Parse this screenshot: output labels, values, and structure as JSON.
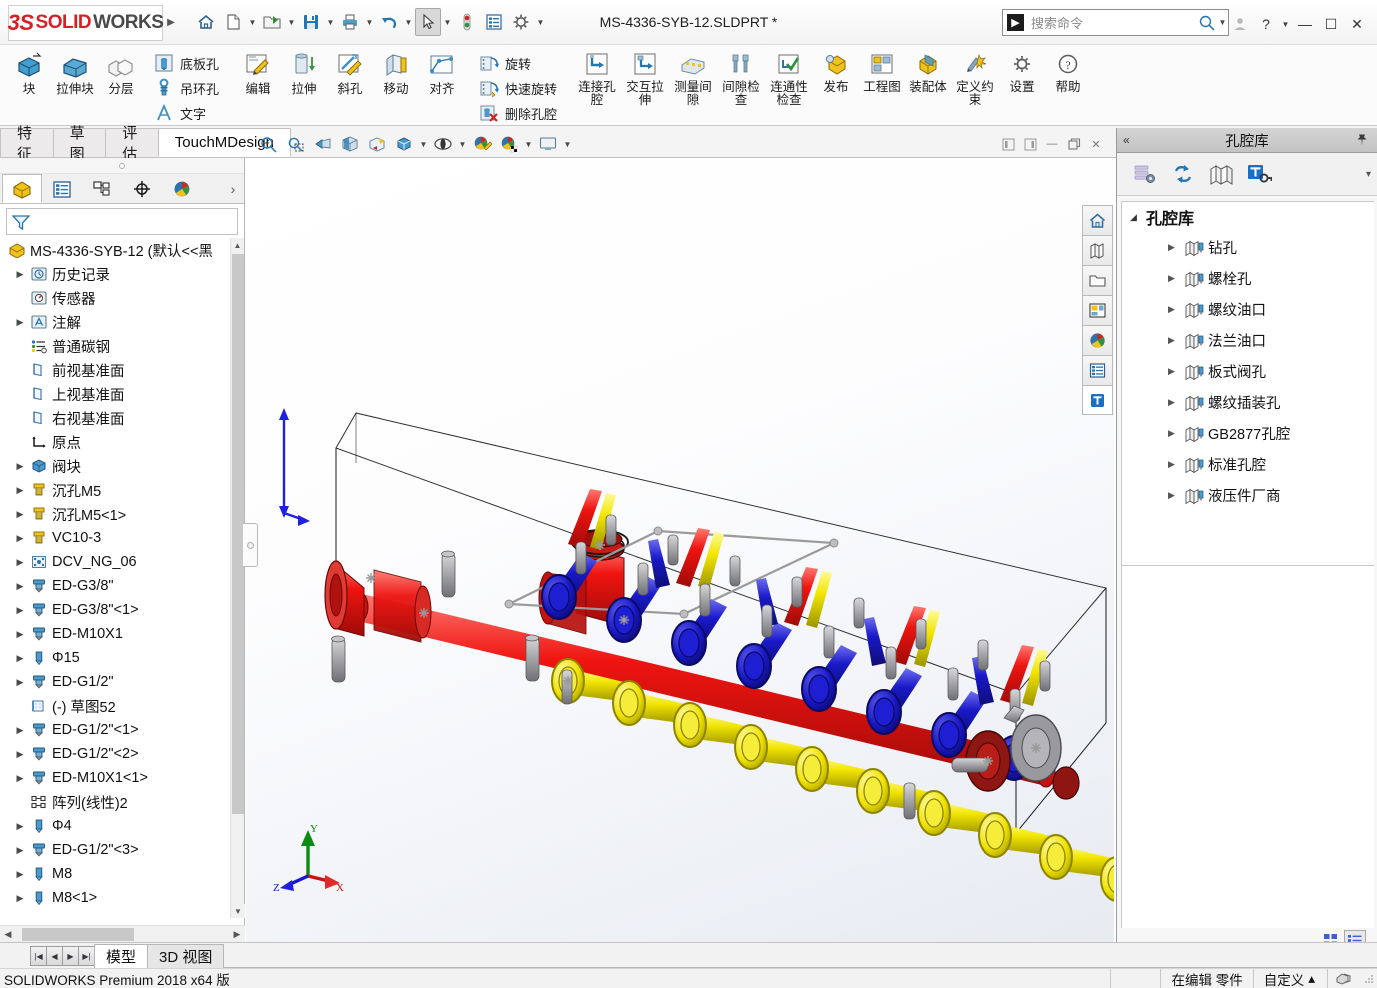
{
  "titlebar": {
    "logo_ds": "3S",
    "logo_solid": "SOLID",
    "logo_works": "WORKS",
    "document_title": "MS-4336-SYB-12.SLDPRT *",
    "search_placeholder": "搜索命令",
    "icons": [
      "home-icon",
      "new-document-icon",
      "open-folder-icon",
      "save-icon",
      "print-icon",
      "undo-icon",
      "select-cursor-icon",
      "rebuild-icon",
      "options-list-icon",
      "settings-gear-icon"
    ],
    "window_buttons": [
      "user-account-icon",
      "help-icon",
      "minimize-icon",
      "maximize-icon",
      "close-icon"
    ]
  },
  "ribbon": {
    "groups": [
      {
        "type": "big",
        "items": [
          {
            "label": "块",
            "label2": "",
            "icon": "block-icon"
          },
          {
            "label": "拉伸块",
            "label2": "",
            "icon": "extrude-block-icon"
          },
          {
            "label": "分层",
            "label2": "",
            "icon": "layer-icon"
          }
        ]
      },
      {
        "type": "stack",
        "items": [
          {
            "label": "底板孔",
            "icon": "base-plate-hole-icon"
          },
          {
            "label": "吊环孔",
            "icon": "eye-bolt-hole-icon"
          },
          {
            "label": "文字",
            "icon": "text-a-icon"
          }
        ]
      },
      {
        "type": "big",
        "items": [
          {
            "label": "编辑",
            "label2": "",
            "icon": "edit-wand-icon"
          },
          {
            "label": "拉伸",
            "label2": "",
            "icon": "extrude-icon"
          },
          {
            "label": "斜孔",
            "label2": "",
            "icon": "angled-hole-icon"
          },
          {
            "label": "移动",
            "label2": "",
            "icon": "move-icon"
          },
          {
            "label": "对齐",
            "label2": "",
            "icon": "align-icon"
          }
        ]
      },
      {
        "type": "stack",
        "items": [
          {
            "label": "旋转",
            "icon": "rotate-icon"
          },
          {
            "label": "快速旋转",
            "icon": "quick-rotate-icon"
          },
          {
            "label": "删除孔腔",
            "icon": "delete-cavity-icon"
          }
        ]
      },
      {
        "type": "big",
        "items": [
          {
            "label": "连接孔",
            "label2": "腔",
            "icon": "connect-hole-icon"
          },
          {
            "label": "交互拉",
            "label2": "伸",
            "icon": "interactive-extrude-icon"
          },
          {
            "label": "测量间",
            "label2": "隙",
            "icon": "measure-gap-icon"
          },
          {
            "label": "间隙检",
            "label2": "查",
            "icon": "clearance-check-icon"
          },
          {
            "label": "连通性",
            "label2": "检查",
            "icon": "connectivity-check-icon"
          },
          {
            "label": "发布",
            "label2": "",
            "icon": "publish-icon"
          },
          {
            "label": "工程图",
            "label2": "",
            "icon": "drawing-icon"
          },
          {
            "label": "装配体",
            "label2": "",
            "icon": "assembly-icon"
          },
          {
            "label": "定义约",
            "label2": "束",
            "icon": "define-constraint-icon"
          },
          {
            "label": "设置",
            "label2": "",
            "icon": "settings-icon"
          },
          {
            "label": "帮助",
            "label2": "",
            "icon": "help-circle-icon"
          }
        ]
      }
    ]
  },
  "command_tabs": {
    "tabs": [
      {
        "label": "特征",
        "active": false
      },
      {
        "label": "草图",
        "active": false
      },
      {
        "label": "评估",
        "active": false
      },
      {
        "label": "TouchMDesign",
        "active": true
      }
    ]
  },
  "feature_manager": {
    "tabs": [
      "feature-tree-icon",
      "property-manager-icon",
      "configuration-manager-icon",
      "dimxpert-icon",
      "display-manager-icon"
    ],
    "more_label": "›",
    "filter_icon": "filter-funnel-icon",
    "filter_value": "",
    "tree": [
      {
        "label": "MS-4336-SYB-12  (默认<<黑",
        "icon": "part-icon",
        "expand": "none",
        "indent": 0,
        "root": true
      },
      {
        "label": "历史记录",
        "icon": "history-icon",
        "expand": "collapsed",
        "indent": 1
      },
      {
        "label": "传感器",
        "icon": "sensor-icon",
        "expand": "none",
        "indent": 1
      },
      {
        "label": "注解",
        "icon": "annotations-icon",
        "expand": "collapsed",
        "indent": 1
      },
      {
        "label": "普通碳钢",
        "icon": "material-icon",
        "expand": "none",
        "indent": 1
      },
      {
        "label": "前视基准面",
        "icon": "plane-icon",
        "expand": "none",
        "indent": 1
      },
      {
        "label": "上视基准面",
        "icon": "plane-icon",
        "expand": "none",
        "indent": 1
      },
      {
        "label": "右视基准面",
        "icon": "plane-icon",
        "expand": "none",
        "indent": 1
      },
      {
        "label": "原点",
        "icon": "origin-icon",
        "expand": "none",
        "indent": 1
      },
      {
        "label": "阀块",
        "icon": "solid-body-icon",
        "expand": "collapsed",
        "indent": 1
      },
      {
        "label": "沉孔M5",
        "icon": "counterbore-icon",
        "expand": "collapsed",
        "indent": 1
      },
      {
        "label": "沉孔M5<1>",
        "icon": "counterbore-icon",
        "expand": "collapsed",
        "indent": 1
      },
      {
        "label": "VC10-3",
        "icon": "counterbore-icon",
        "expand": "collapsed",
        "indent": 1
      },
      {
        "label": "DCV_NG_06",
        "icon": "valve-pattern-icon",
        "expand": "collapsed",
        "indent": 1
      },
      {
        "label": "ED-G3/8\"",
        "icon": "port-hole-icon",
        "expand": "collapsed",
        "indent": 1
      },
      {
        "label": "ED-G3/8\"<1>",
        "icon": "port-hole-icon",
        "expand": "collapsed",
        "indent": 1
      },
      {
        "label": "ED-M10X1",
        "icon": "port-hole-icon",
        "expand": "collapsed",
        "indent": 1
      },
      {
        "label": "Φ15",
        "icon": "drill-hole-icon",
        "expand": "collapsed",
        "indent": 1
      },
      {
        "label": "ED-G1/2\"",
        "icon": "port-hole-icon",
        "expand": "collapsed",
        "indent": 1
      },
      {
        "label": "(-) 草图52",
        "icon": "sketch-icon",
        "expand": "none",
        "indent": 1
      },
      {
        "label": "ED-G1/2\"<1>",
        "icon": "port-hole-icon",
        "expand": "collapsed",
        "indent": 1
      },
      {
        "label": "ED-G1/2\"<2>",
        "icon": "port-hole-icon",
        "expand": "collapsed",
        "indent": 1
      },
      {
        "label": "ED-M10X1<1>",
        "icon": "port-hole-icon",
        "expand": "collapsed",
        "indent": 1
      },
      {
        "label": "阵列(线性)2",
        "icon": "linear-pattern-icon",
        "expand": "none",
        "indent": 1
      },
      {
        "label": "Φ4",
        "icon": "drill-hole-icon",
        "expand": "collapsed",
        "indent": 1
      },
      {
        "label": "ED-G1/2\"<3>",
        "icon": "port-hole-icon",
        "expand": "collapsed",
        "indent": 1
      },
      {
        "label": "M8",
        "icon": "drill-hole-icon",
        "expand": "collapsed",
        "indent": 1
      },
      {
        "label": "M8<1>",
        "icon": "drill-hole-icon",
        "expand": "collapsed",
        "indent": 1
      }
    ]
  },
  "view_toolbar": {
    "buttons": [
      "zoom-to-fit-icon",
      "zoom-to-area-icon",
      "previous-view-icon",
      "section-view-icon",
      "view-orientation-icon",
      "display-style-icon",
      "hide-show-items-icon",
      "edit-appearance-icon",
      "apply-scene-icon",
      "view-settings-icon"
    ],
    "window_controls": [
      "prev-pane-icon",
      "next-pane-icon",
      "minimize-icon",
      "restore-icon",
      "close-icon"
    ]
  },
  "task_pane": {
    "buttons": [
      "home-icon",
      "design-library-icon",
      "file-explorer-icon",
      "view-palette-icon",
      "appearances-icon",
      "custom-properties-icon",
      "touchmdesign-icon"
    ]
  },
  "library_panel": {
    "collapse_icon": "«",
    "title": "孔腔库",
    "pin_icon": "pin-icon",
    "toolbar": [
      "library-settings-icon",
      "refresh-icon",
      "cavity-library-icon",
      "touchm-key-icon"
    ],
    "toolbar_more": "▾",
    "root": {
      "label": "孔腔库",
      "expand": "expanded"
    },
    "items": [
      {
        "label": "钻孔",
        "icon": "cavity-folder-icon"
      },
      {
        "label": "螺栓孔",
        "icon": "cavity-folder-icon"
      },
      {
        "label": "螺纹油口",
        "icon": "cavity-folder-icon"
      },
      {
        "label": "法兰油口",
        "icon": "cavity-folder-icon"
      },
      {
        "label": "板式阀孔",
        "icon": "cavity-folder-icon"
      },
      {
        "label": "螺纹插装孔",
        "icon": "cavity-folder-icon"
      },
      {
        "label": "GB2877孔腔",
        "icon": "cavity-folder-icon"
      },
      {
        "label": "标准孔腔",
        "icon": "cavity-folder-icon"
      },
      {
        "label": "液压件厂商",
        "icon": "cavity-folder-icon"
      }
    ],
    "footer_buttons": [
      "thumbnail-view-icon",
      "list-view-icon"
    ]
  },
  "bottom_tabs": {
    "nav_buttons": [
      "first-tab-icon",
      "prev-tab-icon",
      "next-tab-icon",
      "last-tab-icon"
    ],
    "tabs": [
      {
        "label": "模型",
        "active": true
      },
      {
        "label": "3D 视图",
        "active": false
      }
    ]
  },
  "status_bar": {
    "version": "SOLIDWORKS Premium 2018 x64 版",
    "editing": "在编辑 零件",
    "custom": "自定义",
    "custom_caret": "▴",
    "icon": "overlay-icon"
  },
  "viewport": {
    "triad": {
      "x_label": "X",
      "y_label": "Y",
      "z_label": "Z"
    },
    "model_colors": {
      "main_channel": "#e8100f",
      "secondary_channel": "#1414c8",
      "tertiary_channel": "#f2e600",
      "body_outline": "#000000",
      "background_top": "#ffffff",
      "background_bottom": "#e7ebf2"
    }
  }
}
